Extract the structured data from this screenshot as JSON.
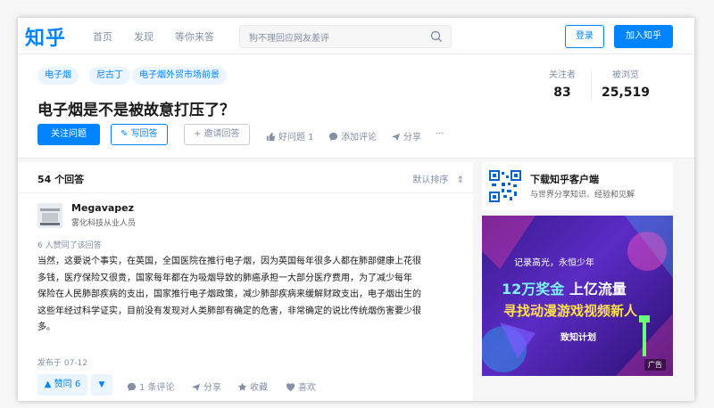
{
  "app": {
    "logo": "知乎"
  },
  "nav": {
    "items": [
      "首页",
      "发现",
      "等你来答"
    ]
  },
  "search": {
    "placeholder": "狗不理回应网友差评"
  },
  "auth": {
    "login_label": "登录",
    "join_label": "加入知乎"
  },
  "question": {
    "tags": [
      "电子烟",
      "尼古丁",
      "电子烟外贸市场前景"
    ],
    "title": "电子烟是不是被故意打压了？",
    "stats": {
      "followers_label": "关注者",
      "followers": "83",
      "views_label": "被浏览",
      "views": "25,519"
    },
    "actions": {
      "follow": "关注问题",
      "write": "写回答",
      "invite": "邀请回答",
      "good": "好问题 1",
      "comment": "添加评论",
      "share": "分享",
      "more": "···"
    }
  },
  "answers": {
    "count": "54 个回答",
    "sort": "默认排序",
    "items": [
      {
        "author": "Megavapez",
        "desc": "雾化科技从业人员",
        "liked": "6 人赞同了该回答",
        "lines": [
          "当然，这要说个事实，在英国，全国医院在推行电子烟，因为英国每年很多人都在肺部健康上花很",
          "多钱，医疗保险又很贵，国家每年都在为吸烟导致的肺癌承担一大部分医疗费用，为了减少每年",
          "保险在人民肺部疾病的支出，国家推行电子烟政策，减少肺部疾病来缓解财政支出，电子烟出生的",
          "这些年经过科学证实，目前没有发现对人类肺部有确定的危害，非常确定的说比传统烟伤害要少很",
          "多。"
        ],
        "date": "发布于 07-12",
        "vote": "▲ 赞同 6",
        "vote_down": "▼",
        "comment": "1 条评论",
        "share": "分享",
        "collect": "收藏",
        "like": "喜欢"
      }
    ]
  },
  "sidebar": {
    "download_title": "下载知乎客户端",
    "download_sub": "与世界分享知识、经验和见解"
  },
  "ad": {
    "line1": "记录高光，永恒少年",
    "prize": "12万奖金",
    "prize2": "上亿流量",
    "main": "寻找动漫游戏视频新人",
    "plan": "致知计划",
    "label": "广告"
  },
  "colors": {
    "brand": "#0084ff",
    "muted": "#8590a6",
    "tag_bg": "#ebf5ff"
  }
}
